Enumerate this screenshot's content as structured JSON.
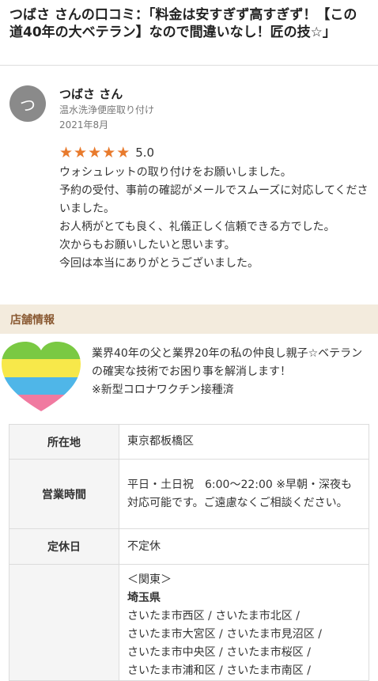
{
  "page": {
    "title": "つばさ さんの口コミ：「料金は安すぎず高すぎず！【この道40年の大ベテラン】なので間違いなし！匠の技☆」"
  },
  "reviewer": {
    "avatar_initial": "つ",
    "name": "つばさ さん",
    "service": "温水洗浄便座取り付け",
    "date": "2021年8月"
  },
  "rating": {
    "stars": 5,
    "score_text": "5.0",
    "star_color": "#e87a2c"
  },
  "review": {
    "lines": [
      "ウォシュレットの取り付けをお願いしました。",
      "予約の受付、事前の確認がメールでスムーズに対応してくださいました。",
      "お人柄がとても良く、礼儀正しく信頼できる方でした。",
      "次からもお願いしたいと思います。",
      "今回は本当にありがとうございました。"
    ]
  },
  "shop": {
    "section_label": "店舗情報",
    "intro_lines": [
      "業界40年の父と業界20年の私の仲良し親子☆ベテランの確実な技術でお困り事を解消します！",
      "※新型コロナワクチン接種済"
    ],
    "heart_colors": [
      "#7ac943",
      "#f7e84a",
      "#4fb6e8",
      "#f07aa0"
    ],
    "table": {
      "location_label": "所在地",
      "location_value": "東京都板橋区",
      "hours_label": "営業時間",
      "hours_value": "平日・土日祝　6:00〜22:00 ※早朝・深夜も対応可能です。ご遠慮なくご相談ください。",
      "holiday_label": "定休日",
      "holiday_value": "不定休",
      "area_region": "＜関東＞",
      "area_pref": "埼玉県",
      "area_lines": [
        "さいたま市西区 / さいたま市北区 /",
        "さいたま市大宮区 / さいたま市見沼区 /",
        "さいたま市中央区 / さいたま市桜区 /",
        "さいたま市浦和区 / さいたま市南区 /"
      ]
    }
  },
  "accent_colors": {
    "section_bg": "#f3ebdd",
    "section_text": "#8a5a33"
  }
}
